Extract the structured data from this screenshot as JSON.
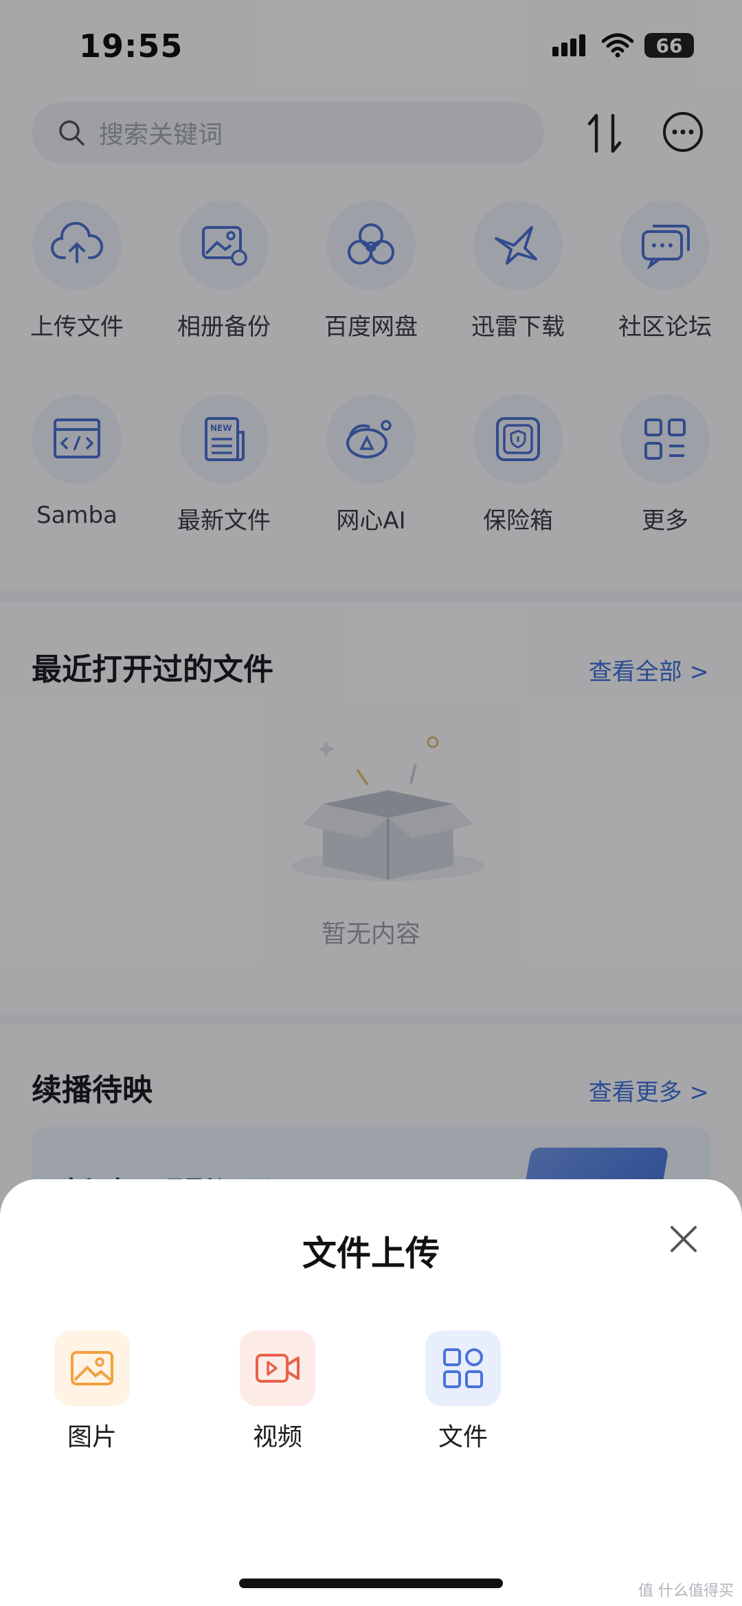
{
  "status_bar": {
    "time": "19:55",
    "battery": "66"
  },
  "search": {
    "placeholder": "搜索关键词"
  },
  "tools": {
    "row1": [
      {
        "label": "上传文件",
        "icon": "cloud-upload-icon"
      },
      {
        "label": "相册备份",
        "icon": "photo-backup-icon"
      },
      {
        "label": "百度网盘",
        "icon": "baidu-netdisk-icon"
      },
      {
        "label": "迅雷下载",
        "icon": "xunlei-bird-icon"
      },
      {
        "label": "社区论坛",
        "icon": "chat-bubbles-icon"
      }
    ],
    "row2": [
      {
        "label": "Samba",
        "icon": "code-window-icon"
      },
      {
        "label": "最新文件",
        "icon": "newspaper-icon"
      },
      {
        "label": "网心AI",
        "icon": "ai-robot-icon"
      },
      {
        "label": "保险箱",
        "icon": "safe-icon"
      },
      {
        "label": "更多",
        "icon": "grid-more-icon"
      }
    ]
  },
  "recent": {
    "title": "最近打开过的文件",
    "link": "查看全部 >",
    "empty_text": "暂无内容"
  },
  "continue": {
    "title": "续播待映",
    "link": "查看更多 >",
    "card_title": "新时下观影记录"
  },
  "upload_sheet": {
    "title": "文件上传",
    "options": [
      {
        "label": "图片",
        "icon": "image-icon",
        "color": "#f2a03d",
        "bg": "#fef3e4"
      },
      {
        "label": "视频",
        "icon": "video-icon",
        "color": "#e8614a",
        "bg": "#fdebe7"
      },
      {
        "label": "文件",
        "icon": "file-grid-icon",
        "color": "#4a72d9",
        "bg": "#e8eefc"
      }
    ]
  },
  "watermark": "值 什么值得买",
  "colors": {
    "accent": "#3f6fd8",
    "icon_blue": "#4a6fd0"
  }
}
